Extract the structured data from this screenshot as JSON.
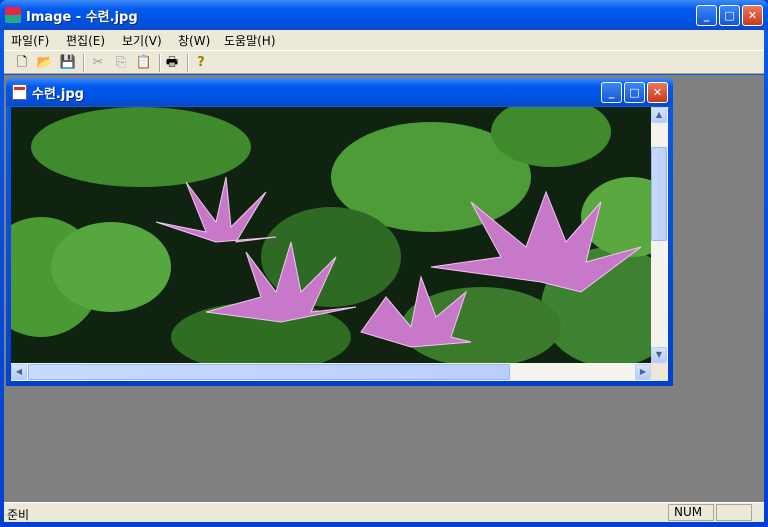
{
  "window": {
    "title": "Image - 수련.jpg",
    "min": "_",
    "max": "□",
    "close": "✕"
  },
  "menu": [
    "파일(F)",
    "편집(E)",
    "보기(V)",
    "창(W)",
    "도움말(H)"
  ],
  "toolbar": {
    "new": "🗋",
    "open": "📂",
    "save": "💾",
    "cut": "✂",
    "copy": "⎘",
    "paste": "📋",
    "print": "🖶",
    "help": "?"
  },
  "child": {
    "title": "수련.jpg",
    "min": "_",
    "max": "□",
    "close": "✕"
  },
  "scroll": {
    "up": "▲",
    "down": "▼",
    "left": "◀",
    "right": "▶",
    "vertical_position": 0.2,
    "horizontal_position": 0
  },
  "status": {
    "text": "준비",
    "num": "NUM"
  }
}
